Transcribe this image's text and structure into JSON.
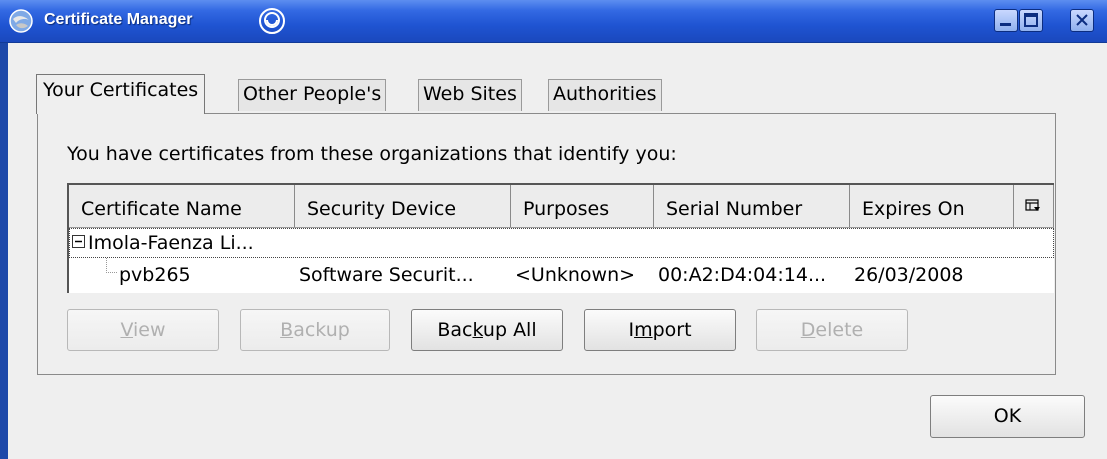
{
  "window": {
    "title": "Certificate Manager"
  },
  "tabs": [
    {
      "label": "Your Certificates",
      "active": true
    },
    {
      "label": "Other People's",
      "active": false
    },
    {
      "label": "Web Sites",
      "active": false
    },
    {
      "label": "Authorities",
      "active": false
    }
  ],
  "panel": {
    "intro": "You have certificates from these organizations that identify you:"
  },
  "table": {
    "columns": [
      "Certificate Name",
      "Security Device",
      "Purposes",
      "Serial Number",
      "Expires On"
    ],
    "groups": [
      {
        "name": "Imola-Faenza Li...",
        "expanded": true,
        "rows": [
          {
            "certificate_name": "pvb265",
            "security_device": "Software Securit...",
            "purposes": "<Unknown>",
            "serial_number": "00:A2:D4:04:14...",
            "expires_on": "26/03/2008"
          }
        ]
      }
    ]
  },
  "buttons": {
    "view": {
      "pre": "",
      "key": "V",
      "post": "iew",
      "enabled": false
    },
    "backup": {
      "pre": "",
      "key": "B",
      "post": "ackup",
      "enabled": false
    },
    "backup_all": {
      "pre": "Bac",
      "key": "k",
      "post": "up All",
      "enabled": true
    },
    "import": {
      "pre": "I",
      "key": "m",
      "post": "port",
      "enabled": true
    },
    "delete": {
      "pre": "",
      "key": "D",
      "post": "elete",
      "enabled": false
    },
    "ok": "OK"
  },
  "colors": {
    "titlebar": "#1f54d2",
    "background": "#efefef",
    "disabled_text": "#b0b0b0"
  },
  "icons": {
    "app": "globe-app-icon",
    "title_badge": "emblem-icon",
    "minimize": "minimize-icon",
    "maximize": "maximize-icon",
    "close": "close-icon",
    "column_picker": "column-picker-icon",
    "expander": "collapse-icon"
  }
}
